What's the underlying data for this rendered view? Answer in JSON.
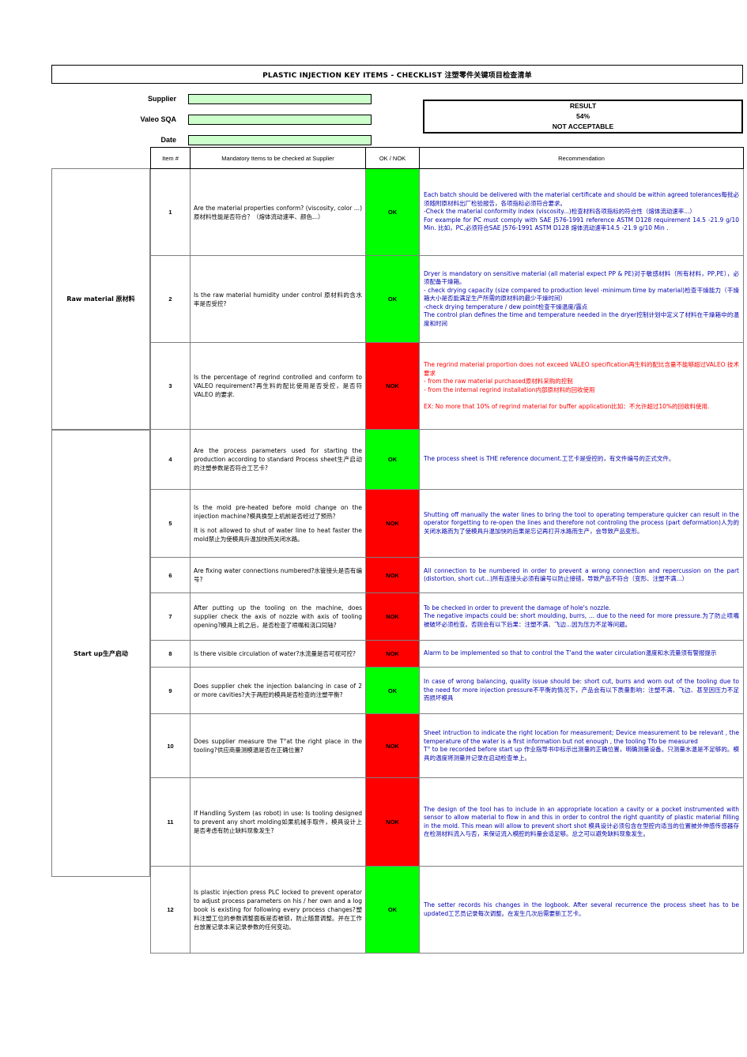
{
  "document": {
    "title": "PLASTIC INJECTION KEY ITEMS - CHECKLIST 注塑零件关键项目检查清单"
  },
  "info": {
    "labels": {
      "supplier": "Supplier",
      "valeo_sqa": "Valeo SQA",
      "date": "Date"
    },
    "values": {
      "supplier": "",
      "valeo_sqa": "",
      "date": ""
    },
    "field_color": "#ccffcc"
  },
  "result": {
    "heading": "RESULT",
    "percent": "54%",
    "verdict": "NOT ACCEPTABLE"
  },
  "table": {
    "headers": {
      "item": "Item #",
      "description": "Mandatory Items to be checked at Supplier",
      "status": "OK / NOK",
      "recommendation": "Recommendation"
    },
    "status_colors": {
      "ok": "#00ff00",
      "nok": "#ff0000"
    }
  },
  "categories": [
    {
      "id": "raw-material",
      "label": "Raw material 原材料"
    },
    {
      "id": "start-up",
      "label": "Start up生产启动"
    }
  ],
  "rows": [
    {
      "item": "1",
      "description": "Are the material properties conform? (viscosity, color ...)原材料性能是否符合？（熔体流动速率、颜色...）",
      "status": "OK",
      "status_key": "ok",
      "recommendation_alert": false,
      "recommendation": "Each batch should be delivered with the material certificate and should be within agreed tolerances每批必须随附原材料出厂检验报告，各项指标必须符合要求。\n-Check the material conformity index (viscosity...)检查材料各项指标的符合性（熔体流动速率...）\nFor example for PC must comply with  SAE J576-1991 reference ASTM D128 requirement 14.5 -21.9 g/10 Min. 比如，PC,必须符合SAE J576-1991 ASTM D128 熔体流动速率14.5 -21.9 g/10 Min ."
    },
    {
      "item": "2",
      "description": "Is the raw material humidity under control 原材料的含水率是否受控?",
      "status": "OK",
      "status_key": "ok",
      "recommendation_alert": false,
      "recommendation": "Dryer is mandatory on sensitive material (all material expect PP & PE)对于敏感材料（所有材料，PP,PE），必须配备干燥箱。\n - check drying capacity (size compared to production level -minimum time by material)检查干燥能力（干燥箱大小是否能满足生产所需的原材料的最少干燥时间）\n-check drying temperature / dew point检查干燥温度/露点\nThe control plan defines the time and temperature needed in the dryer控制计划中定义了材料在干燥箱中的温度和时间"
    },
    {
      "item": "3",
      "description": "Is the percentage of regrind controlled and conform to VALEO requirement?再生料的配比使用是否受控，是否符VALEO 的要求.",
      "status": "NOK",
      "status_key": "nok",
      "recommendation_alert": true,
      "recommendation": "The regrind material proportion does not exceed VALEO specification再生料的配比含量不能够超过VALEO 技术要求\n- from the raw material purchased原材料采购的控制\n- from the internal regrind installation内部原材料的回收使用\n\nEX: No more that 10% of regrind material for buffer application比如：不允许超过10%的回收料使用."
    },
    {
      "item": "4",
      "description": "Are the process parameters used for starting the production according to standard Process sheet生产启动的注塑参数是否符合工艺卡?",
      "status": "OK",
      "status_key": "ok",
      "recommendation_alert": false,
      "recommendation": "The process sheet is THE reference document.工艺卡是受控的，有文件编号的正式文件。"
    },
    {
      "item": "5",
      "description": "Is the mold pre-heated before mold change on the injection machine?模具换型上机前是否经过了预热？\nIt is not allowed to shut of water line to heat faster the mold禁止为使模具升温加快而关闭水路。",
      "status": "NOK",
      "status_key": "nok",
      "recommendation_alert": false,
      "recommendation": "Shutting off manually the water lines to bring the tool to operating temperature quicker can result in the operator forgetting to re-open the lines and therefore not controling the process (part deformation)人为的关闭水路而为了使模具升温加快的后果是忘记再打开水路而生产，会导致产品变形。"
    },
    {
      "item": "6",
      "description": "Are fixing water connections numbered?水管接头是否有编号?",
      "status": "NOK",
      "status_key": "nok",
      "recommendation_alert": false,
      "recommendation": "All connection to be numbered in order to prevent a wrong connection and repercussion on the part (distortion, short cut...)所有连接头必须有编号以防止接错，导致产品不符合（变形、注塑不满...）"
    },
    {
      "item": "7",
      "description": "After putting up the tooling on the machine, does supplier check the axis of nozzle with axis of tooling opening?模具上机之后，是否检查了喷嘴和浇口同轴?",
      "status": "NOK",
      "status_key": "nok",
      "recommendation_alert": false,
      "recommendation": "To be checked in order to prevent the damage of hole's nozzle.\nThe negative impacts could be: short moulding, burrs, ... due to the need for more pressure.为了防止喷嘴被破坏必须检查。否则会有以下后果：注塑不满、飞边...因为压力不足等问题。"
    },
    {
      "item": "8",
      "description": "Is there visible circulation of water?水流量是否可视可控?",
      "status": "NOK",
      "status_key": "nok",
      "recommendation_alert": false,
      "recommendation": "Alarm to be implemented so that to control the T'and the water circulation温度和水流量须有警报提示"
    },
    {
      "item": "9",
      "description": "Does  supplier chek the injection balancing in case of 2 or more cavities?大于两腔的模具是否检查的注塑平衡?",
      "status": "OK",
      "status_key": "ok",
      "recommendation_alert": false,
      "recommendation": "In case of wrong balancing, quality issue should be: short cut, burrs and worn out of the tooling due to the need for more injection pressure不平衡的情况下，产品会有以下质量影响：注塑不满、飞边、甚至因压力不足而损坏模具"
    },
    {
      "item": "10",
      "description": "Does supplier measure the T°at the right place in the tooling?供应商量测模温是否在正确位置?",
      "status": "NOK",
      "status_key": "nok",
      "recommendation_alert": false,
      "recommendation": "Sheet intruction to indicate the right location for measurement; Device measurement to be relevant , the temperature of the water is a first information but not enough , the tooling Tfo be measured\nT° to be recorded before start up 作业指导书中标示出测量的正确位置，明确测量设备。只测量水温是不足够的。模具的温度将测量并记录在启动检查单上。"
    },
    {
      "item": "11",
      "description": "If Handling System (as robot) in use: Is tooling designed to prevent any short molding如果机械手取件，模具设计上是否考虑有防止缺料现象发生?",
      "status": "NOK",
      "status_key": "nok",
      "recommendation_alert": false,
      "recommendation": "The design of the tool has to include in an appropriate location a cavity or a pocket instrumented with sensor to allow material to flow in and this in order to control the right quantity of plastic material filling in the mold. This mean will allow to prevent short shot 模具设计必须包含在型腔内适当的位置被外伸感传感器存在检测材料流入与否，来保证流入模腔的料量会适足够。总之可以避免缺料现象发生。"
    },
    {
      "item": "12",
      "description": "Is plastic injection press PLC locked to prevent operator to adjust process parameters on his / her own and a log book is existing for following every process changes?塑料注塑工位的参数调整面板是否被锁，防止随意调整。并在工作台放置记录本来记录参数的任何变动。",
      "status": "OK",
      "status_key": "ok",
      "recommendation_alert": false,
      "recommendation": "The setter records his changes in the logbook. After several recurrence the process sheet has to be updated工艺员记录每次调整。在发生几次后需要新工艺卡。"
    }
  ]
}
